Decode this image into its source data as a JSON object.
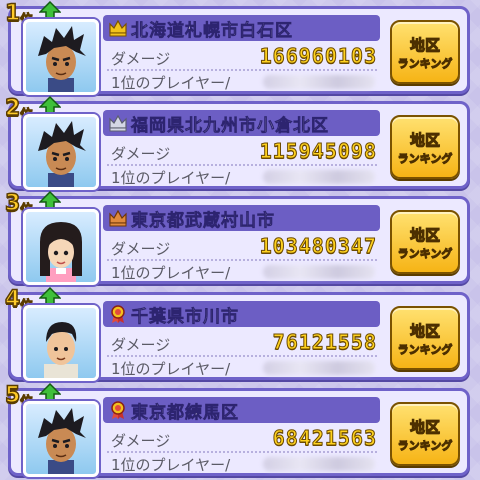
{
  "rankings": [
    {
      "rank": "1",
      "rank_suffix": "位",
      "trend": "up",
      "medal": "crown-gold",
      "avatar": "dark-spiky-hair-boy",
      "region": "北海道札幌市白石区",
      "damage_label": "ダメージ",
      "damage": "166960103",
      "player_label": "1位のプレイヤー/",
      "button_line1": "地区",
      "button_line2": "ランキング"
    },
    {
      "rank": "2",
      "rank_suffix": "位",
      "trend": "up",
      "medal": "crown-silver",
      "avatar": "dark-spiky-hair-boy",
      "region": "福岡県北九州市小倉北区",
      "damage_label": "ダメージ",
      "damage": "115945098",
      "player_label": "1位のプレイヤー/",
      "button_line1": "地区",
      "button_line2": "ランキング"
    },
    {
      "rank": "3",
      "rank_suffix": "位",
      "trend": "up",
      "medal": "crown-bronze",
      "avatar": "black-hair-girl",
      "region": "東京都武蔵村山市",
      "damage_label": "ダメージ",
      "damage": "103480347",
      "player_label": "1位のプレイヤー/",
      "button_line1": "地区",
      "button_line2": "ランキング"
    },
    {
      "rank": "4",
      "rank_suffix": "位",
      "trend": "up",
      "medal": "ribbon",
      "avatar": "short-hair-man",
      "region": "千葉県市川市",
      "damage_label": "ダメージ",
      "damage": "76121558",
      "player_label": "1位のプレイヤー/",
      "button_line1": "地区",
      "button_line2": "ランキング"
    },
    {
      "rank": "5",
      "rank_suffix": "位",
      "trend": "up",
      "medal": "ribbon",
      "avatar": "dark-spiky-hair-boy",
      "region": "東京都練馬区",
      "damage_label": "ダメージ",
      "damage": "68421563",
      "player_label": "1位のプレイヤー/",
      "button_line1": "地区",
      "button_line2": "ランキング"
    }
  ],
  "colors": {
    "background": "#c9c3ea",
    "row_fill": "#ece9ff",
    "row_border": "#6f62c9",
    "name_bar": "#6c5ec4",
    "damage_gold": "#ffd21f",
    "button_gold": "#f6b416",
    "trend_up": "#3fbf3a"
  }
}
